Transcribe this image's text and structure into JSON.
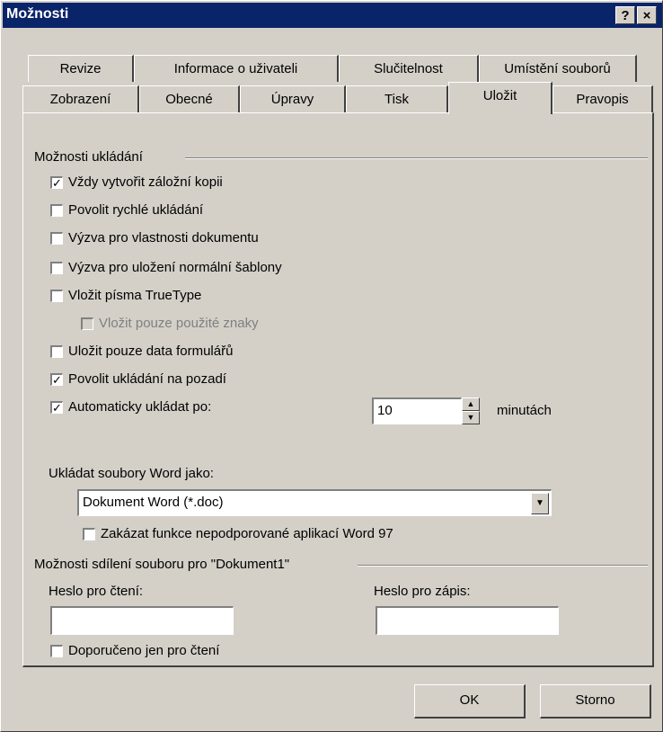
{
  "window": {
    "title": "Možnosti",
    "help_icon": "?",
    "close_icon": "×"
  },
  "tabs_row1": [
    "Revize",
    "Informace o uživateli",
    "Slučitelnost",
    "Umístění souborů"
  ],
  "tabs_row2": [
    "Zobrazení",
    "Obecné",
    "Úpravy",
    "Tisk",
    "Uložit",
    "Pravopis"
  ],
  "active_tab": "Uložit",
  "save_options": {
    "header": "Možnosti ukládání",
    "items": [
      {
        "label": "Vždy vytvořit záložní kopii",
        "checked": true
      },
      {
        "label": "Povolit rychlé ukládání",
        "checked": false
      },
      {
        "label": "Výzva pro vlastnosti dokumentu",
        "checked": false
      },
      {
        "label": "Výzva pro uložení normální šablony",
        "checked": false
      },
      {
        "label": "Vložit písma TrueType",
        "checked": false
      },
      {
        "label": "Vložit pouze použité znaky",
        "checked": false,
        "disabled": true
      },
      {
        "label": "Uložit pouze data formulářů",
        "checked": false
      },
      {
        "label": "Povolit ukládání na pozadí",
        "checked": true
      },
      {
        "label": "Automaticky ukládat po:",
        "checked": true
      }
    ],
    "autosave_value": "10",
    "autosave_unit": "minutách",
    "save_as_label": "Ukládat soubory Word jako:",
    "save_as_value": "Dokument Word (*.doc)",
    "disable_features_label": "Zakázat funkce nepodporované aplikací Word 97",
    "disable_features_checked": false
  },
  "sharing": {
    "header": "Možnosti sdílení souboru pro \"Dokument1\"",
    "read_password_label": "Heslo pro čtení:",
    "read_password_value": "",
    "write_password_label": "Heslo pro zápis:",
    "write_password_value": "",
    "readonly_label": "Doporučeno jen pro čtení",
    "readonly_checked": false
  },
  "buttons": {
    "ok": "OK",
    "cancel": "Storno"
  }
}
